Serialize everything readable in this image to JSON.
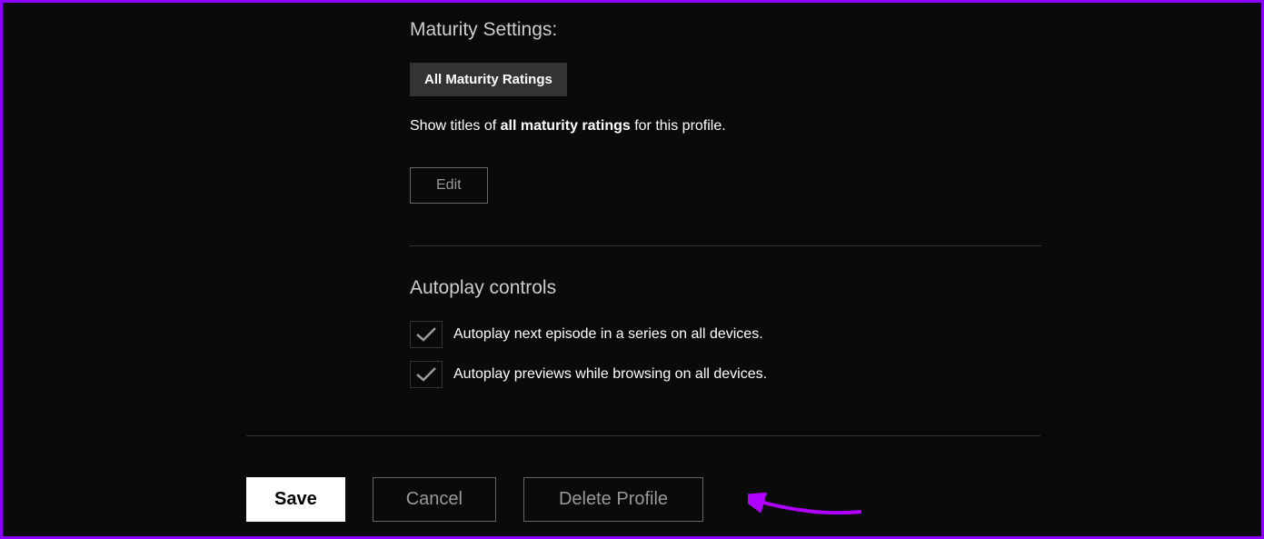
{
  "maturity": {
    "title": "Maturity Settings:",
    "rating_badge": "All Maturity Ratings",
    "description_prefix": "Show titles of ",
    "description_bold": "all maturity ratings",
    "description_suffix": " for this profile.",
    "edit_label": "Edit"
  },
  "autoplay": {
    "title": "Autoplay controls",
    "option1": "Autoplay next episode in a series on all devices.",
    "option2": "Autoplay previews while browsing on all devices."
  },
  "actions": {
    "save": "Save",
    "cancel": "Cancel",
    "delete": "Delete Profile"
  }
}
